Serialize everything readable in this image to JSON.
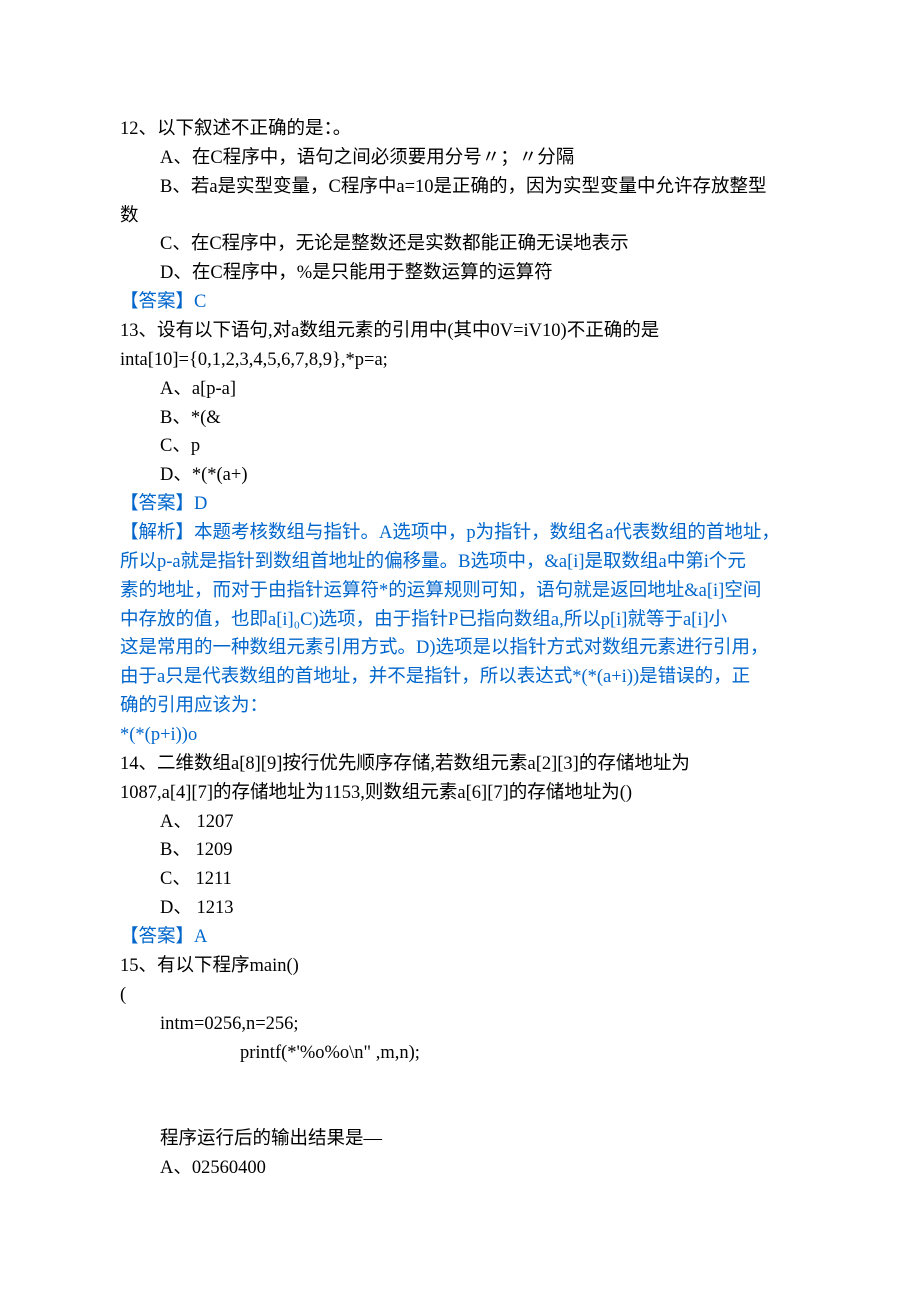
{
  "q12": {
    "stem": "12、以下叙述不正确的是：。",
    "optA": "A、在C程序中，语句之间必须要用分号〃；〃分隔",
    "optB_p1": "B、若a是实型变量，C程序中a=10是正确的，因为实型变量中允许存放整型",
    "optB_p2": "数",
    "optC": "C、在C程序中，无论是整数还是实数都能正确无误地表示",
    "optD": "D、在C程序中，%是只能用于整数运算的运算符",
    "answer": "【答案】C"
  },
  "q13": {
    "stem_l1": "13、设有以下语句,对a数组元素的引用中(其中0V=iV10)不正确的是",
    "stem_l2": "inta[10]={0,1,2,3,4,5,6,7,8,9},*p=a;",
    "optA": "A、a[p-a]",
    "optB": "B、*(&",
    "optC": "C、p",
    "optD": "D、*(*(a+)",
    "answer": "【答案】D",
    "analysis_l1": "【解析】本题考核数组与指针。A选项中，p为指针，数组名a代表数组的首地址，",
    "analysis_l2": "所以p-a就是指针到数组首地址的偏移量。B选项中，&a[i]是取数组a中第i个元",
    "analysis_l3": "素的地址，而对于由指针运算符*的运算规则可知，语句就是返回地址&a[i]空间",
    "analysis_l4": "中存放的值，也即a[i]₀C)选项，由于指针P已指向数组a,所以p[i]就等于a[i]小",
    "analysis_l5": "这是常用的一种数组元素引用方式。D)选项是以指针方式对数组元素进行引用，",
    "analysis_l6": "由于a只是代表数组的首地址，并不是指针，所以表达式*(*(a+i))是错误的，正",
    "analysis_l7": "确的引用应该为：",
    "analysis_l8": "*(*(p+i))o"
  },
  "q14": {
    "stem_l1": "14、二维数组a[8][9]按行优先顺序存储,若数组元素a[2][3]的存储地址为",
    "stem_l2": "1087,a[4][7]的存储地址为1153,则数组元素a[6][7]的存储地址为()",
    "optA": "A、 1207",
    "optB": "B、 1209",
    "optC": "C、 1211",
    "optD": "D、 1213",
    "answer": "【答案】A"
  },
  "q15": {
    "stem": "15、有以下程序main()",
    "brace": "(",
    "code_l1": "intm=0256,n=256;",
    "code_l2": "printf(*'%o%o\\n\" ,m,n);",
    "blank1": "",
    "blank2": "",
    "tail": "程序运行后的输出结果是—",
    "optA": "A、02560400"
  }
}
